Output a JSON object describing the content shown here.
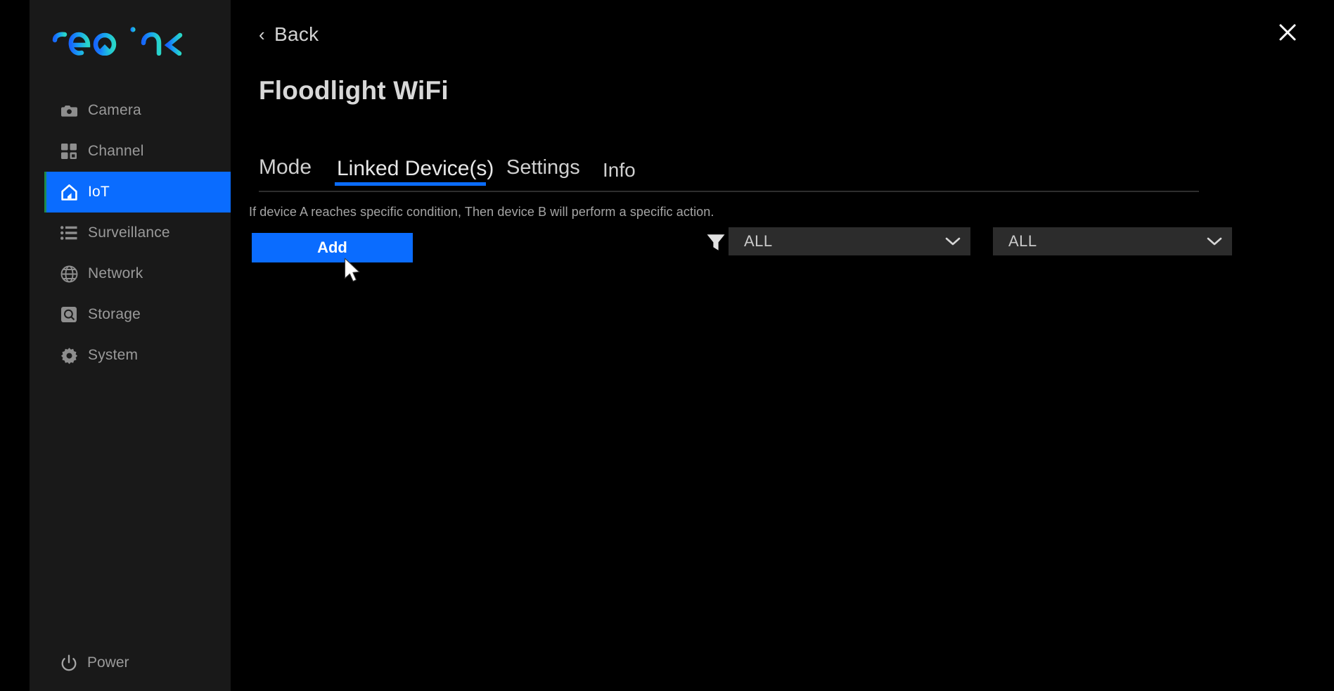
{
  "app": {
    "brand": "reolink",
    "brand_colors": {
      "start": "#1766ff",
      "mid": "#18a0f0",
      "end": "#29d6c8"
    }
  },
  "sidebar": {
    "items": [
      {
        "label": "Camera",
        "icon": "camera-icon",
        "active": false
      },
      {
        "label": "Channel",
        "icon": "grid-icon",
        "active": false
      },
      {
        "label": "IoT",
        "icon": "home-icon",
        "active": true
      },
      {
        "label": "Surveillance",
        "icon": "list-icon",
        "active": false
      },
      {
        "label": "Network",
        "icon": "globe-icon",
        "active": false
      },
      {
        "label": "Storage",
        "icon": "hard-drive-icon",
        "active": false
      },
      {
        "label": "System",
        "icon": "gear-icon",
        "active": false
      }
    ],
    "power": {
      "label": "Power",
      "icon": "power-icon"
    },
    "active_color": "#0a6cff"
  },
  "header": {
    "back_label": "Back",
    "back_icon": "chevron-left-icon",
    "close_icon": "close-icon",
    "title": "Floodlight WiFi"
  },
  "tabs": [
    {
      "label": "Mode",
      "active": false
    },
    {
      "label": "Linked Device(s)",
      "active": true
    },
    {
      "label": "Settings",
      "active": false
    },
    {
      "label": "Info",
      "active": false
    }
  ],
  "content": {
    "description": "If device A reaches specific condition, Then device B will perform a specific action.",
    "add_label": "Add",
    "filter_icon": "filter-icon",
    "dropdowns": [
      {
        "value": "ALL",
        "chevron": "chevron-down-icon"
      },
      {
        "value": "ALL",
        "chevron": "chevron-down-icon"
      }
    ]
  },
  "cursor": {
    "icon": "mouse-pointer-icon"
  }
}
